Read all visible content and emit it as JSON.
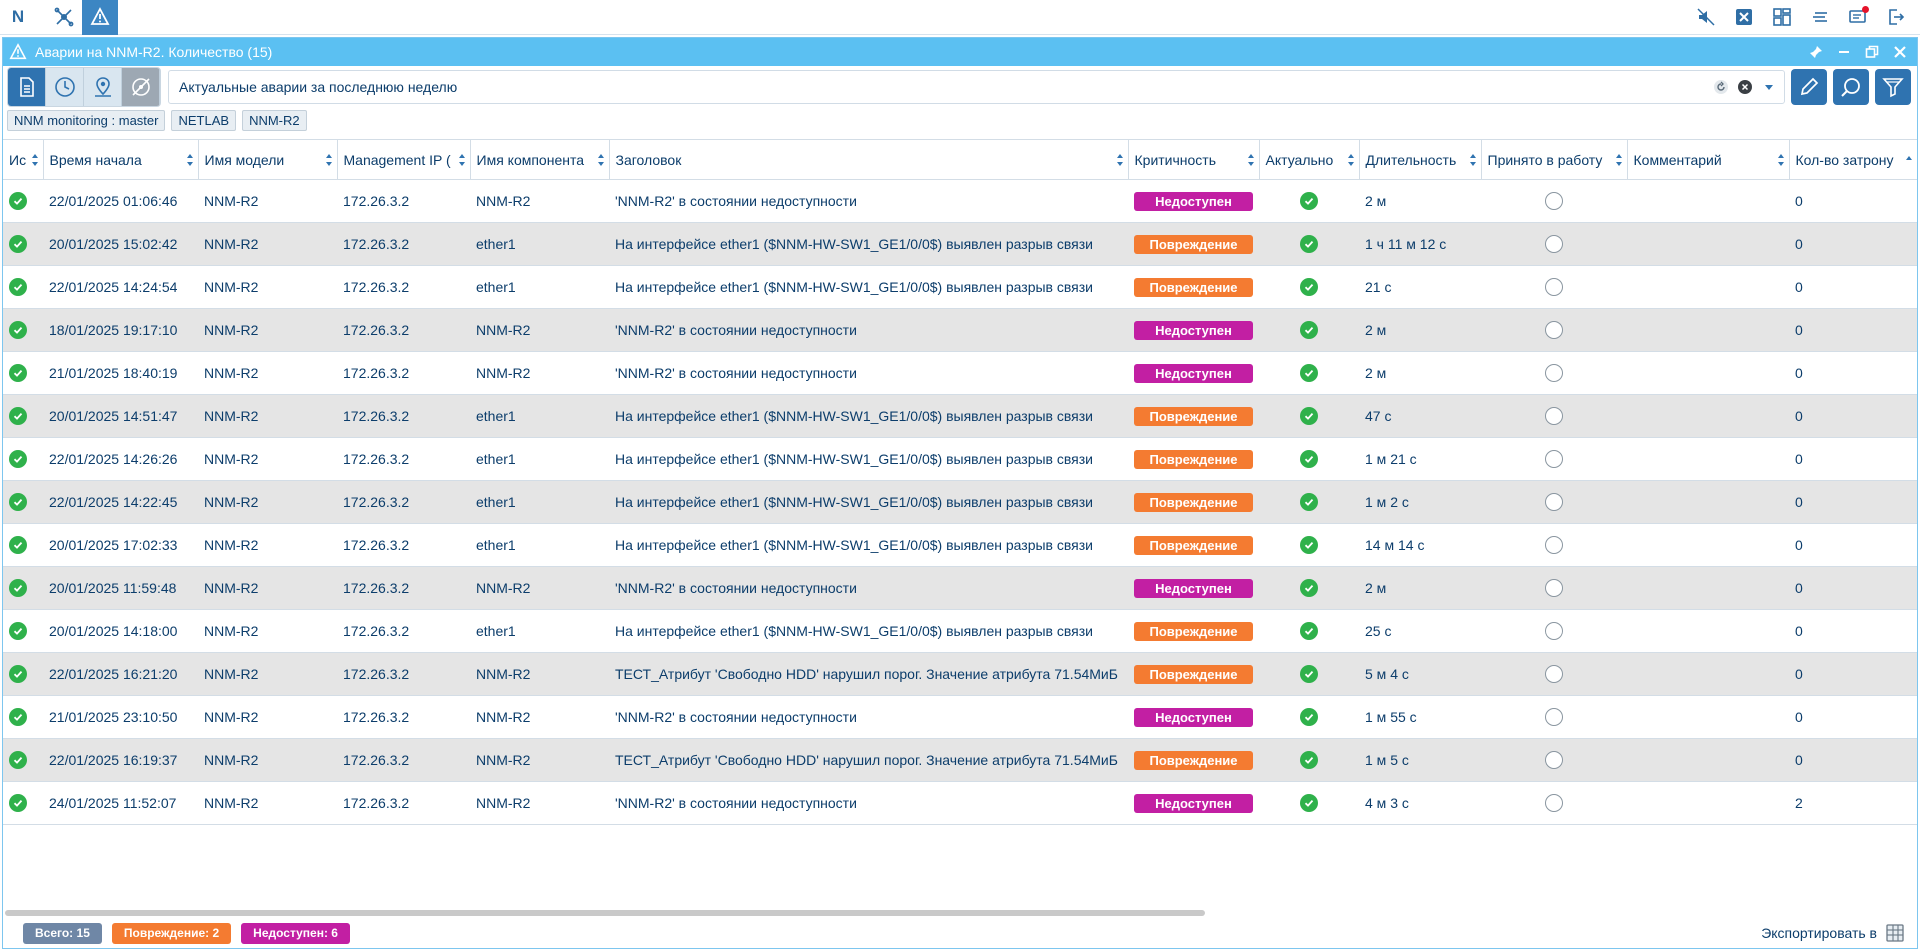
{
  "topbar": {
    "logo": "N",
    "icons": [
      "network-icon",
      "alarm-icon"
    ],
    "right_icons": [
      "sound-off-icon",
      "close-box-icon",
      "dashboard-icon",
      "list-icon",
      "notifications-icon",
      "logout-icon"
    ]
  },
  "window": {
    "title": "Аварии на NNM-R2. Количество (15)"
  },
  "search": {
    "value": "Актуальные аварии за последнюю неделю"
  },
  "chips": [
    "NNM monitoring : master",
    "NETLAB",
    "NNM-R2"
  ],
  "columns": [
    "Ис",
    "Время начала",
    "Имя модели",
    "Management IP (",
    "Имя компонента",
    "Заголовок",
    "Критичность",
    "Актуально",
    "Длительность",
    "Принято в работу",
    "Комментарий",
    "Кол-во затрону"
  ],
  "colors": {
    "unavailable": "#c21fa3",
    "damage": "#f47b31",
    "total": "#6f87a6",
    "ok": "#2fb14b",
    "accent": "#2f73b0",
    "titlebar": "#5bc0f2"
  },
  "rows": [
    {
      "time": "22/01/2025 01:06:46",
      "model": "NNM-R2",
      "ip": "172.26.3.2",
      "component": "NNM-R2",
      "title": "'NNM-R2' в состоянии недоступности",
      "severity": "Недоступен",
      "sev_type": "unavailable",
      "duration": "2 м",
      "count": "0"
    },
    {
      "time": "20/01/2025 15:02:42",
      "model": "NNM-R2",
      "ip": "172.26.3.2",
      "component": "ether1",
      "title": "На интерфейсе ether1 ($NNM-HW-SW1_GE1/0/0$) выявлен разрыв связи",
      "severity": "Повреждение",
      "sev_type": "damage",
      "duration": "1 ч 11 м 12 с",
      "count": "0"
    },
    {
      "time": "22/01/2025 14:24:54",
      "model": "NNM-R2",
      "ip": "172.26.3.2",
      "component": "ether1",
      "title": "На интерфейсе ether1 ($NNM-HW-SW1_GE1/0/0$) выявлен разрыв связи",
      "severity": "Повреждение",
      "sev_type": "damage",
      "duration": "21 с",
      "count": "0"
    },
    {
      "time": "18/01/2025 19:17:10",
      "model": "NNM-R2",
      "ip": "172.26.3.2",
      "component": "NNM-R2",
      "title": "'NNM-R2' в состоянии недоступности",
      "severity": "Недоступен",
      "sev_type": "unavailable",
      "duration": "2 м",
      "count": "0"
    },
    {
      "time": "21/01/2025 18:40:19",
      "model": "NNM-R2",
      "ip": "172.26.3.2",
      "component": "NNM-R2",
      "title": "'NNM-R2' в состоянии недоступности",
      "severity": "Недоступен",
      "sev_type": "unavailable",
      "duration": "2 м",
      "count": "0"
    },
    {
      "time": "20/01/2025 14:51:47",
      "model": "NNM-R2",
      "ip": "172.26.3.2",
      "component": "ether1",
      "title": "На интерфейсе ether1 ($NNM-HW-SW1_GE1/0/0$) выявлен разрыв связи",
      "severity": "Повреждение",
      "sev_type": "damage",
      "duration": "47 с",
      "count": "0"
    },
    {
      "time": "22/01/2025 14:26:26",
      "model": "NNM-R2",
      "ip": "172.26.3.2",
      "component": "ether1",
      "title": "На интерфейсе ether1 ($NNM-HW-SW1_GE1/0/0$) выявлен разрыв связи",
      "severity": "Повреждение",
      "sev_type": "damage",
      "duration": "1 м 21 с",
      "count": "0"
    },
    {
      "time": "22/01/2025 14:22:45",
      "model": "NNM-R2",
      "ip": "172.26.3.2",
      "component": "ether1",
      "title": "На интерфейсе ether1 ($NNM-HW-SW1_GE1/0/0$) выявлен разрыв связи",
      "severity": "Повреждение",
      "sev_type": "damage",
      "duration": "1 м 2 с",
      "count": "0"
    },
    {
      "time": "20/01/2025 17:02:33",
      "model": "NNM-R2",
      "ip": "172.26.3.2",
      "component": "ether1",
      "title": "На интерфейсе ether1 ($NNM-HW-SW1_GE1/0/0$) выявлен разрыв связи",
      "severity": "Повреждение",
      "sev_type": "damage",
      "duration": "14 м 14 с",
      "count": "0"
    },
    {
      "time": "20/01/2025 11:59:48",
      "model": "NNM-R2",
      "ip": "172.26.3.2",
      "component": "NNM-R2",
      "title": "'NNM-R2' в состоянии недоступности",
      "severity": "Недоступен",
      "sev_type": "unavailable",
      "duration": "2 м",
      "count": "0"
    },
    {
      "time": "20/01/2025 14:18:00",
      "model": "NNM-R2",
      "ip": "172.26.3.2",
      "component": "ether1",
      "title": "На интерфейсе ether1 ($NNM-HW-SW1_GE1/0/0$) выявлен разрыв связи",
      "severity": "Повреждение",
      "sev_type": "damage",
      "duration": "25 с",
      "count": "0"
    },
    {
      "time": "22/01/2025 16:21:20",
      "model": "NNM-R2",
      "ip": "172.26.3.2",
      "component": "NNM-R2",
      "title": "ТЕСТ_Атрибут 'Свободно HDD' нарушил порог. Значение атрибута 71.54МиБ",
      "severity": "Повреждение",
      "sev_type": "damage",
      "duration": "5 м 4 с",
      "count": "0"
    },
    {
      "time": "21/01/2025 23:10:50",
      "model": "NNM-R2",
      "ip": "172.26.3.2",
      "component": "NNM-R2",
      "title": "'NNM-R2' в состоянии недоступности",
      "severity": "Недоступен",
      "sev_type": "unavailable",
      "duration": "1 м 55 с",
      "count": "0"
    },
    {
      "time": "22/01/2025 16:19:37",
      "model": "NNM-R2",
      "ip": "172.26.3.2",
      "component": "NNM-R2",
      "title": "ТЕСТ_Атрибут 'Свободно HDD' нарушил порог. Значение атрибута 71.54МиБ",
      "severity": "Повреждение",
      "sev_type": "damage",
      "duration": "1 м 5 с",
      "count": "0"
    },
    {
      "time": "24/01/2025 11:52:07",
      "model": "NNM-R2",
      "ip": "172.26.3.2",
      "component": "NNM-R2",
      "title": "'NNM-R2' в состоянии недоступности",
      "severity": "Недоступен",
      "sev_type": "unavailable",
      "duration": "4 м 3 с",
      "count": "2"
    }
  ],
  "footer": {
    "total": "Всего: 15",
    "damage": "Повреждение: 2",
    "unavailable": "Недоступен: 6",
    "export": "Экспортировать в"
  }
}
